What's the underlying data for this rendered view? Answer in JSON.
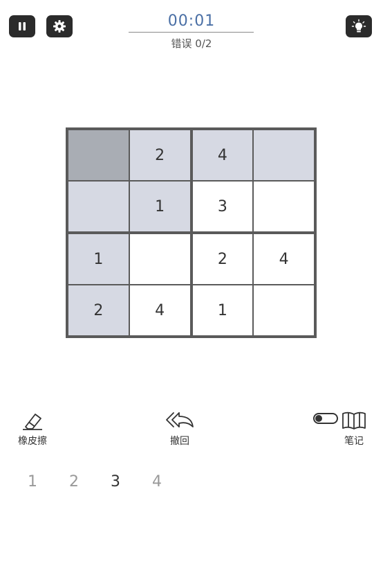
{
  "header": {
    "timer": "00:01",
    "mistakes": "错误 0/2"
  },
  "board": {
    "size": 4,
    "cells": [
      {
        "row": 0,
        "col": 0,
        "value": "",
        "state": "selected"
      },
      {
        "row": 0,
        "col": 1,
        "value": "2",
        "state": "shaded"
      },
      {
        "row": 0,
        "col": 2,
        "value": "4",
        "state": "shaded"
      },
      {
        "row": 0,
        "col": 3,
        "value": "",
        "state": "shaded"
      },
      {
        "row": 1,
        "col": 0,
        "value": "",
        "state": "shaded"
      },
      {
        "row": 1,
        "col": 1,
        "value": "1",
        "state": "shaded"
      },
      {
        "row": 1,
        "col": 2,
        "value": "3",
        "state": "normal"
      },
      {
        "row": 1,
        "col": 3,
        "value": "",
        "state": "normal"
      },
      {
        "row": 2,
        "col": 0,
        "value": "1",
        "state": "shaded"
      },
      {
        "row": 2,
        "col": 1,
        "value": "",
        "state": "normal"
      },
      {
        "row": 2,
        "col": 2,
        "value": "2",
        "state": "normal"
      },
      {
        "row": 2,
        "col": 3,
        "value": "4",
        "state": "normal"
      },
      {
        "row": 3,
        "col": 0,
        "value": "2",
        "state": "shaded"
      },
      {
        "row": 3,
        "col": 1,
        "value": "4",
        "state": "normal"
      },
      {
        "row": 3,
        "col": 2,
        "value": "1",
        "state": "normal"
      },
      {
        "row": 3,
        "col": 3,
        "value": "",
        "state": "normal"
      }
    ]
  },
  "tools": {
    "eraser_label": "橡皮擦",
    "undo_label": "撤回",
    "notes_label": "笔记",
    "notes_enabled": false
  },
  "number_pad": [
    {
      "label": "1",
      "active": false
    },
    {
      "label": "2",
      "active": false
    },
    {
      "label": "3",
      "active": true
    },
    {
      "label": "4",
      "active": false
    }
  ],
  "colors": {
    "timer": "#4a6fa5",
    "shaded_cell": "#d6d9e3",
    "selected_cell": "#a9adb4",
    "board_border": "#5a5a5a"
  }
}
